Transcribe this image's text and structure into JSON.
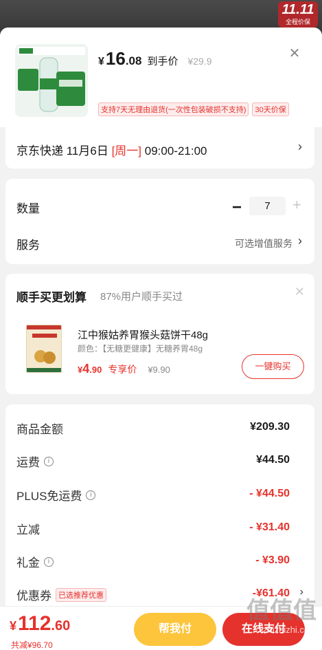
{
  "promo_badge": {
    "big": "11.11",
    "small": "全程价保"
  },
  "product": {
    "price_yen": "¥",
    "price_int": "16",
    "price_dec": ".08",
    "price_tag": "到手价",
    "orig_price": "¥29.9",
    "tags": [
      "支持7天无理由退货(一次性包装破损不支持)",
      "30天价保"
    ]
  },
  "delivery": {
    "prefix": "京东快递 11月6日 ",
    "weekday": "[周一]",
    "time": " 09:00-21:00"
  },
  "quantity": {
    "label": "数量",
    "value": "7",
    "minus": "−",
    "plus": "+"
  },
  "service": {
    "label": "服务",
    "value": "可选增值服务"
  },
  "bundle": {
    "title": "顺手买更划算",
    "subtitle": "87%用户顺手买过",
    "item_name": "江中猴姑养胃猴头菇饼干48g",
    "item_spec": "颜色：【无糖更健康】无糖养胃48g",
    "price_yen": "¥",
    "price_int": "4",
    "price_dec": ".90",
    "price_tag": "专享价",
    "orig_price": "¥9.90",
    "buy_label": "一键购买"
  },
  "summary": [
    {
      "label": "商品金额",
      "value": "¥209.30",
      "red": false,
      "info": false
    },
    {
      "label": "运费",
      "value": "¥44.50",
      "red": false,
      "info": true
    },
    {
      "label": "PLUS免运费",
      "value": "- ¥44.50",
      "red": true,
      "info": true
    },
    {
      "label": "立减",
      "value": "- ¥31.40",
      "red": true,
      "info": false
    },
    {
      "label": "礼金",
      "value": "- ¥3.90",
      "red": true,
      "info": true
    },
    {
      "label": "优惠券",
      "value": "-¥61.40",
      "red": true,
      "info": false,
      "badge": "已选推荐优惠"
    }
  ],
  "bottom": {
    "total_yen": "¥",
    "total_int": "112",
    "total_dec": ".60",
    "saved": "共减¥96.70",
    "help_label": "帮我付",
    "pay_label": "在线支付"
  },
  "watermark": {
    "logo": "值值值",
    "url": "zhizhizhi.com"
  },
  "colors": {
    "accent_red": "#e5322d",
    "help_yellow": "#fdc53c"
  }
}
